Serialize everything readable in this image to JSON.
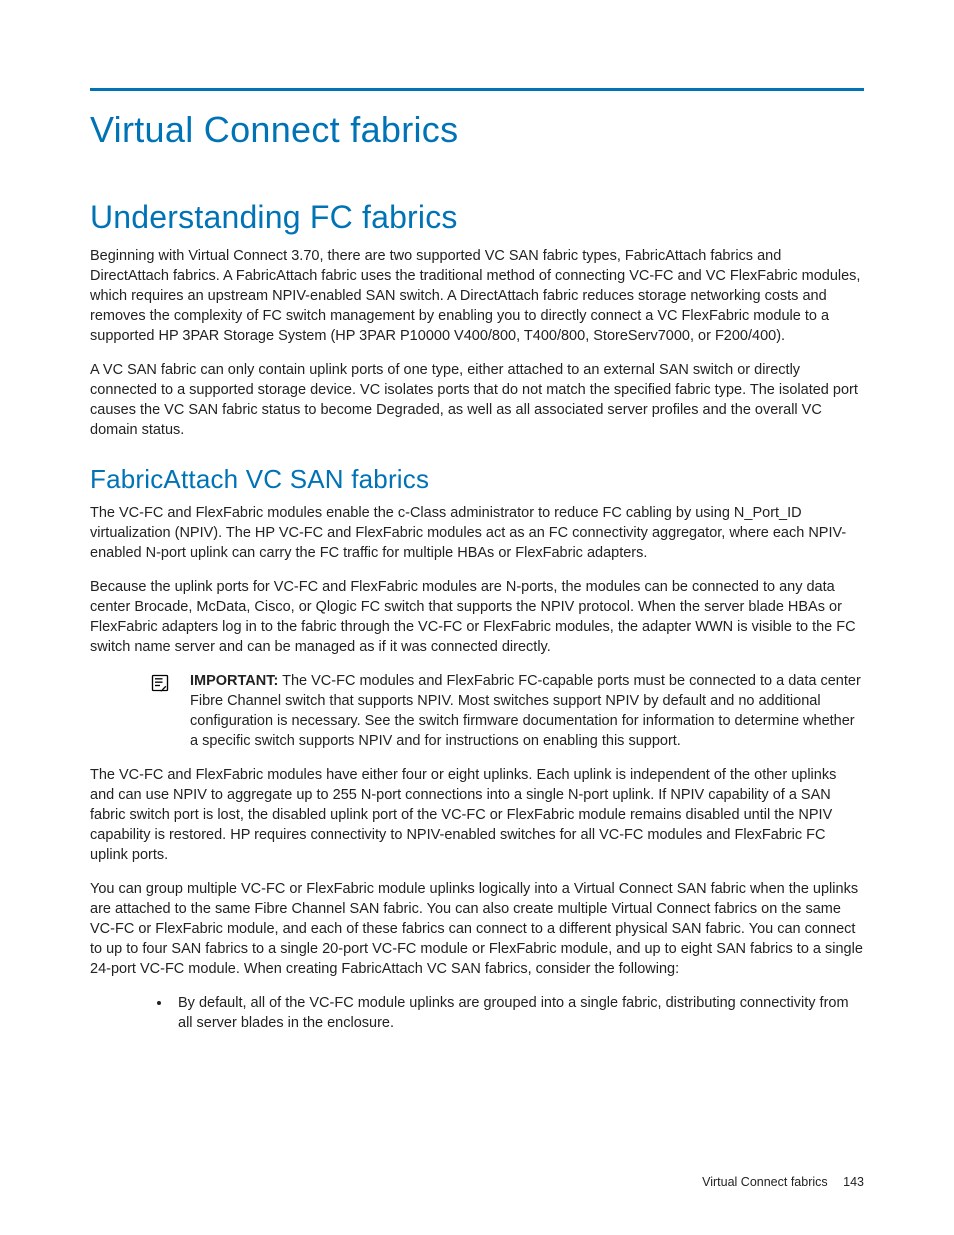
{
  "page": {
    "title": "Virtual Connect fabrics",
    "section": "Understanding FC fabrics",
    "p1": "Beginning with Virtual Connect 3.70, there are two supported VC SAN fabric types, FabricAttach fabrics and DirectAttach fabrics. A FabricAttach fabric uses the traditional method of connecting VC-FC and VC FlexFabric modules, which requires an upstream NPIV-enabled SAN switch. A DirectAttach fabric reduces storage networking costs and removes the complexity of FC switch management by enabling you to directly connect a VC FlexFabric module to a supported HP 3PAR Storage System (HP 3PAR P10000 V400/800, T400/800, StoreServ7000, or F200/400).",
    "p2": "A VC SAN fabric can only contain uplink ports of one type, either attached to an external SAN switch or directly connected to a supported storage device. VC isolates ports that do not match the specified fabric type. The isolated port causes the VC SAN fabric status to become Degraded, as well as all associated server profiles and the overall VC domain status.",
    "sub1": {
      "title": "FabricAttach VC SAN fabrics",
      "p1": "The VC-FC and FlexFabric modules enable the c-Class administrator to reduce FC cabling by using N_Port_ID virtualization (NPIV). The HP VC-FC and FlexFabric modules act as an FC connectivity aggregator, where each NPIV-enabled N-port uplink can carry the FC traffic for multiple HBAs or FlexFabric adapters.",
      "p2": "Because the uplink ports for VC-FC and FlexFabric modules are N-ports, the modules can be connected to any data center Brocade, McData, Cisco, or Qlogic FC switch that supports the NPIV protocol. When the server blade HBAs or FlexFabric adapters log in to the fabric through the VC-FC or FlexFabric modules, the adapter WWN is visible to the FC switch name server and can be managed as if it was connected directly.",
      "important_label": "IMPORTANT:",
      "important_body": " The VC-FC modules and FlexFabric FC-capable ports must be connected to a data center Fibre Channel switch that supports NPIV. Most switches support NPIV by default and no additional configuration is necessary. See the switch firmware documentation for information to determine whether a specific switch supports NPIV and for instructions on enabling this support.",
      "p3": "The VC-FC and FlexFabric modules have either four or eight uplinks. Each uplink is independent of the other uplinks and can use NPIV to aggregate up to 255 N-port connections into a single N-port uplink. If NPIV capability of a SAN fabric switch port is lost, the disabled uplink port of the VC-FC or FlexFabric module remains disabled until the NPIV capability is restored. HP requires connectivity to NPIV-enabled switches for all VC-FC modules and FlexFabric FC uplink ports.",
      "p4": "You can group multiple VC-FC or FlexFabric module uplinks logically into a Virtual Connect SAN fabric when the uplinks are attached to the same Fibre Channel SAN fabric. You can also create multiple Virtual Connect fabrics on the same VC-FC or FlexFabric module, and each of these fabrics can connect to a different physical SAN fabric. You can connect to up to four SAN fabrics to a single 20-port VC-FC module or FlexFabric module, and up to eight SAN fabrics to a single 24-port VC-FC module. When creating FabricAttach VC SAN fabrics, consider the following:",
      "bullets": [
        "By default, all of the VC-FC module uplinks are grouped into a single fabric, distributing connectivity from all server blades in the enclosure."
      ]
    },
    "footer": {
      "text": "Virtual Connect fabrics",
      "page": "143"
    }
  }
}
